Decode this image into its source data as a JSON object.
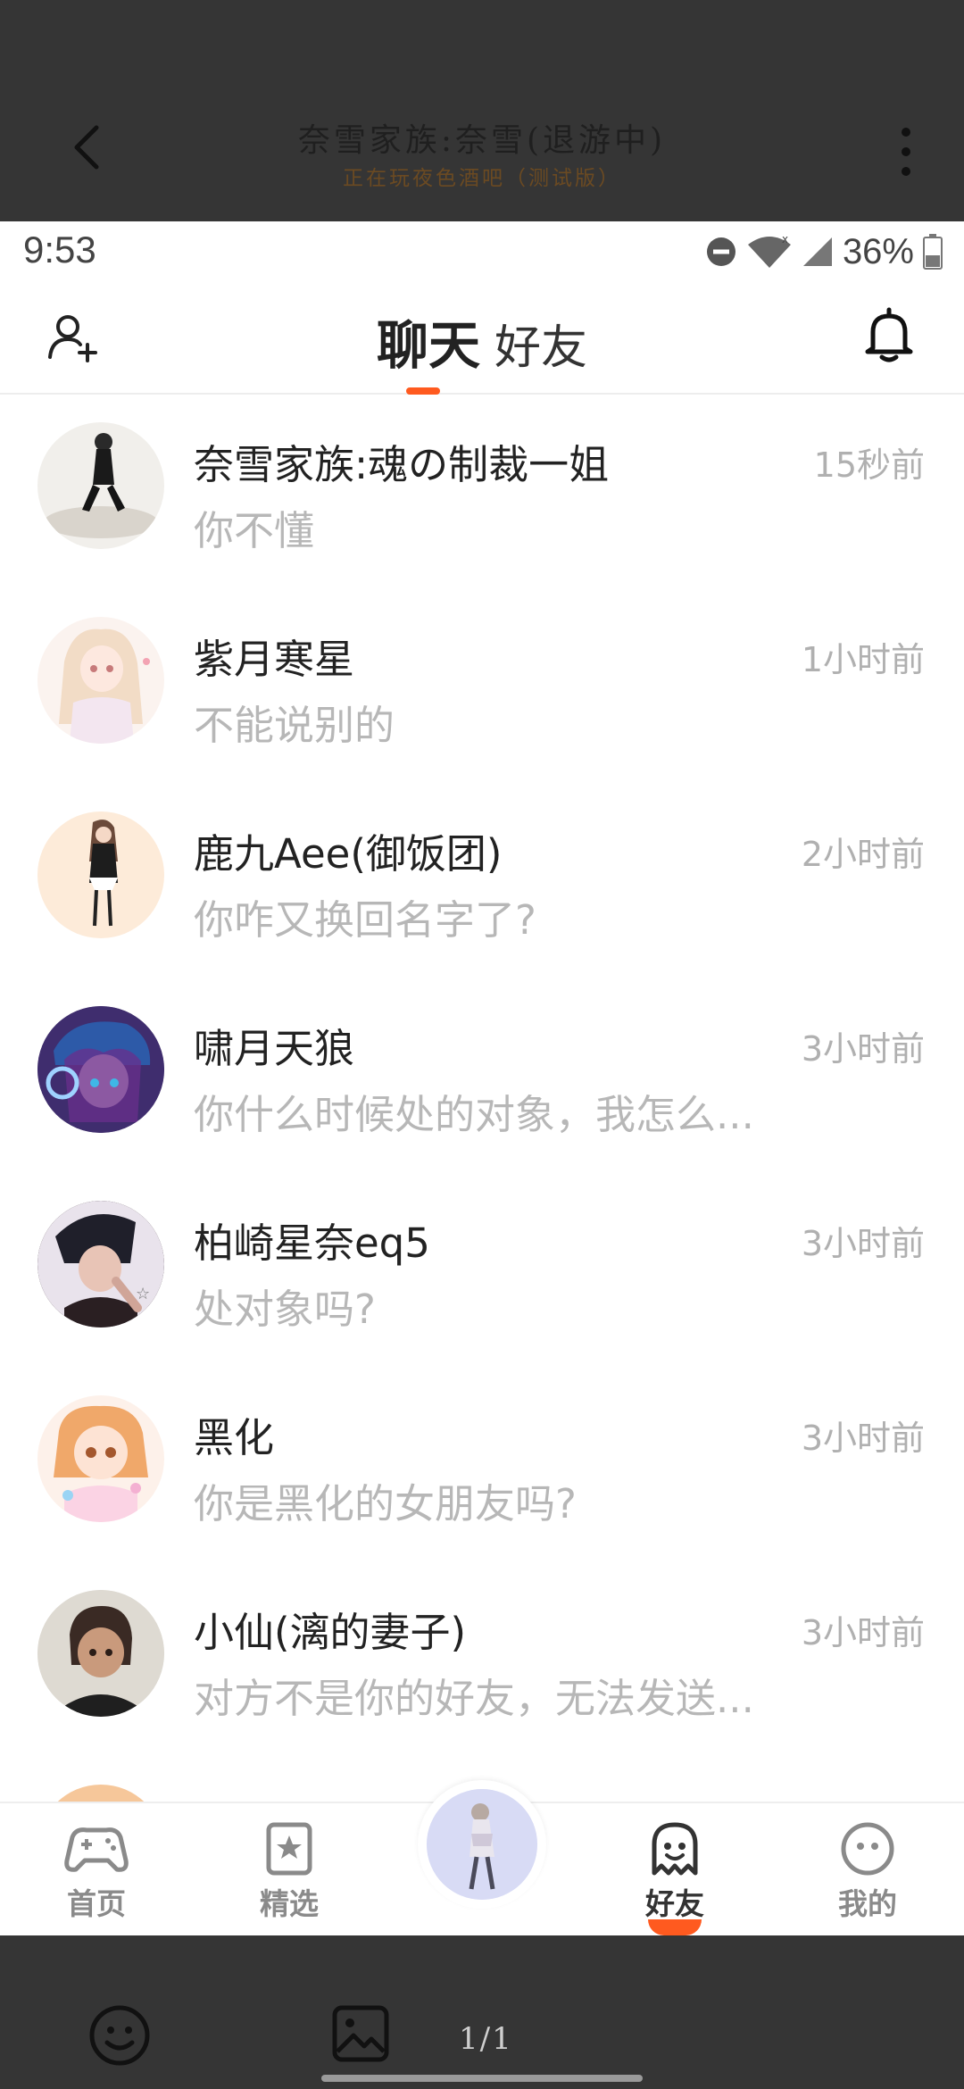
{
  "overlay": {
    "title": "奈雪家族:奈雪(退游中)",
    "subtitle": "正在玩夜色酒吧（测试版）",
    "page_counter": "1/1"
  },
  "status_bar": {
    "time": "9:53",
    "battery": "36%"
  },
  "header": {
    "tab_chat": "聊天",
    "tab_friends": "好友"
  },
  "chats": [
    {
      "name": "奈雪家族:魂の制裁一姐",
      "message": "你不懂",
      "time": "15秒前",
      "avatar_color": "#e8e6e2"
    },
    {
      "name": "紫月寒星",
      "message": "不能说别的",
      "time": "1小时前",
      "avatar_color": "#f7ece6"
    },
    {
      "name": "鹿九Aee(御饭团)",
      "message": "你咋又换回名字了?",
      "time": "2小时前",
      "avatar_color": "#fde9d6"
    },
    {
      "name": "啸月天狼",
      "message": "你什么时候处的对象，我怎么...",
      "time": "3小时前",
      "avatar_color": "#3b2a5e"
    },
    {
      "name": "柏崎星奈eq5",
      "message": "处对象吗?",
      "time": "3小时前",
      "avatar_color": "#4a3a44"
    },
    {
      "name": "黑化",
      "message": "你是黑化的女朋友吗?",
      "time": "3小时前",
      "avatar_color": "#fbe6d8"
    },
    {
      "name": "小仙(漓的妻子)",
      "message": "对方不是你的好友，无法发送...",
      "time": "3小时前",
      "avatar_color": "#dcd8d0"
    }
  ],
  "nav": {
    "home": "首页",
    "featured": "精选",
    "friends": "好友",
    "mine": "我的"
  },
  "colors": {
    "accent": "#ff5a1f",
    "overlay": "#353535"
  }
}
